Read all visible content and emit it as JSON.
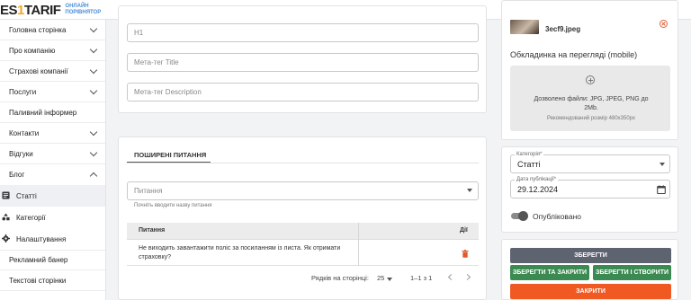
{
  "header": {
    "logo_part1": "ES",
    "logo_accent": "1",
    "logo_part2": "TARIF",
    "logo_sub_line1": "ОНЛАЙН",
    "logo_sub_line2": "ПОРІВНЯТОР"
  },
  "sidebar": {
    "items": [
      {
        "label": "Головна сторінка"
      },
      {
        "label": "Про компанію"
      },
      {
        "label": "Страхові компанії"
      },
      {
        "label": "Послуги"
      },
      {
        "label": "Паливний інформер"
      },
      {
        "label": "Контакти"
      },
      {
        "label": "Відгуки"
      },
      {
        "label": "Блог"
      }
    ],
    "blog_sub": [
      {
        "label": "Статті",
        "icon": "article-icon"
      },
      {
        "label": "Категорії",
        "icon": "category-icon"
      },
      {
        "label": "Налаштування",
        "icon": "gear-icon"
      }
    ],
    "extra": [
      {
        "label": "Рекламний банер"
      },
      {
        "label": "Текстові сторінки"
      }
    ]
  },
  "seo": {
    "h1_placeholder": "H1",
    "meta_title_placeholder": "Мета-тег Title",
    "meta_description_placeholder": "Мета-тег Description"
  },
  "faq": {
    "tab_label": "ПОШИРЕНІ ПИТАННЯ",
    "select_placeholder": "Питання",
    "helper_text": "Почніть вводити назву питання",
    "col_question": "Питання",
    "col_actions": "Дії",
    "rows": [
      {
        "question": "Не виходить завантажити поліс за посиланням із листа. Як отримати страховку?"
      }
    ],
    "pagination": {
      "rows_label": "Рядків на сторінці:",
      "rows_value": "25",
      "range": "1–1 з 1"
    }
  },
  "media": {
    "file_name": "3ecf9.jpeg",
    "mobile_cover_title": "Обкладинка на перегляді (mobile)",
    "upload_text": "Дозволено файли: JPG, JPEG, PNG до 2Mb.",
    "upload_hint": "Рекомендований розмір 480x350px"
  },
  "publish": {
    "category_label": "Категорія*",
    "category_value": "Статті",
    "date_label": "Дата публікації*",
    "date_value": "29.12.2024",
    "published_label": "Опубліковано",
    "published": true
  },
  "actions": {
    "save": "ЗБЕРЕГТИ",
    "save_close": "ЗБЕРЕГТИ ТА ЗАКРИТИ",
    "save_create": "ЗБЕРЕГТИ І СТВОРИТИ",
    "close": "ЗАКРИТИ"
  },
  "colors": {
    "save": "#5d6470",
    "save_close": "#3b8a52",
    "save_create": "#3b8a52",
    "close": "#f05a22",
    "delete_icon": "#e05a2b"
  }
}
